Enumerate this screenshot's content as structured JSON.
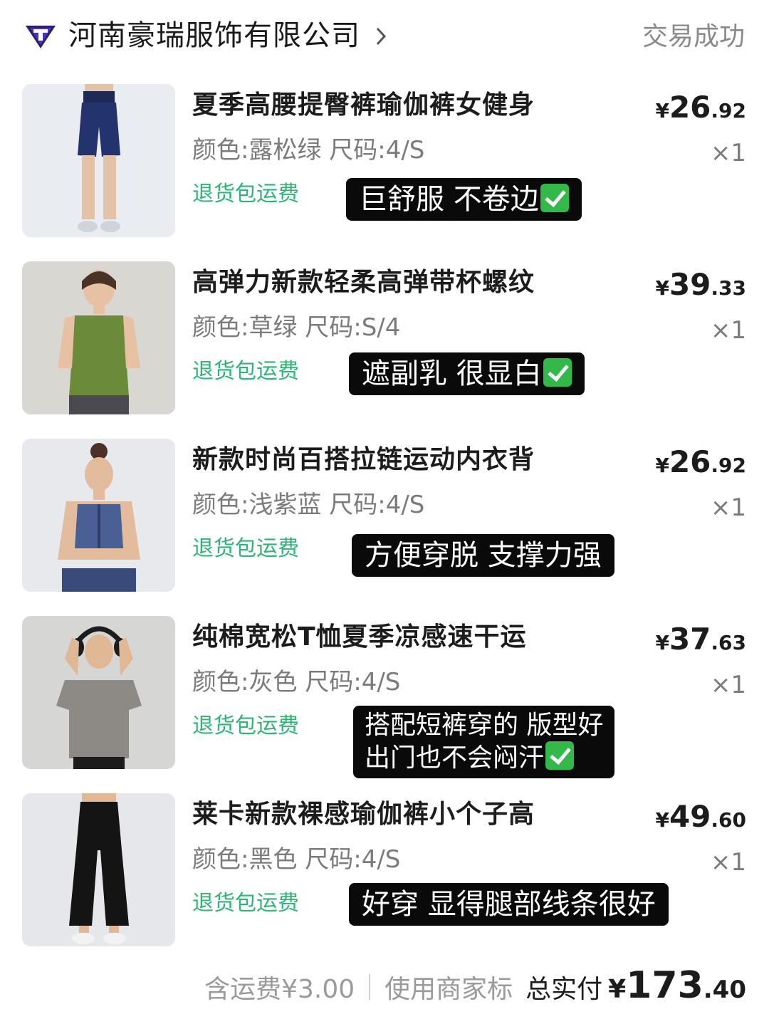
{
  "shop": {
    "name": "河南豪瑞服饰有限公司",
    "status": "交易成功",
    "icons": {
      "logo": "shop-logo-icon",
      "chevron": "chevron-right-icon"
    },
    "colors": {
      "logo": "#2b1e6e",
      "status": "#8a8a8a"
    }
  },
  "items": [
    {
      "title": "夏季高腰提臀裤瑜伽裤女健身",
      "spec": "颜色:露松绿 尺码:4/S",
      "service": "退货包运费",
      "price_currency": "¥",
      "price_int": "26",
      "price_dec": ".92",
      "qty": "×1",
      "note_lines": [
        "巨舒服 不卷边"
      ],
      "note_check": true,
      "image": "navy-biker-shorts"
    },
    {
      "title": "高弹力新款轻柔高弹带杯螺纹",
      "spec": "颜色:草绿 尺码:S/4",
      "service": "退货包运费",
      "price_currency": "¥",
      "price_int": "39",
      "price_dec": ".33",
      "qty": "×1",
      "note_lines": [
        "遮副乳 很显白"
      ],
      "note_check": true,
      "image": "green-tank-top"
    },
    {
      "title": "新款时尚百搭拉链运动内衣背",
      "spec": "颜色:浅紫蓝 尺码:4/S",
      "service": "退货包运费",
      "price_currency": "¥",
      "price_int": "26",
      "price_dec": ".92",
      "qty": "×1",
      "note_lines": [
        "方便穿脱 支撑力强"
      ],
      "note_check": false,
      "image": "blue-zip-sports-bra"
    },
    {
      "title": "纯棉宽松T恤夏季凉感速干运",
      "spec": "颜色:灰色 尺码:4/S",
      "service": "退货包运费",
      "price_currency": "¥",
      "price_int": "37",
      "price_dec": ".63",
      "qty": "×1",
      "note_lines": [
        "搭配短裤穿的 版型好",
        "出门也不会闷汗"
      ],
      "note_check": true,
      "image": "grey-loose-tshirt"
    },
    {
      "title": "莱卡新款裸感瑜伽裤小个子高",
      "spec": "颜色:黑色 尺码:4/S",
      "service": "退货包运费",
      "price_currency": "¥",
      "price_int": "49",
      "price_dec": ".60",
      "qty": "×1",
      "note_lines": [
        "好穿 显得腿部线条很好"
      ],
      "note_check": false,
      "image": "black-flare-yoga-pants"
    }
  ],
  "summary": {
    "shipping": "含运费¥3.00",
    "discount": "使用商家标",
    "total_label": "总实付",
    "total_currency": "¥",
    "total_int": "173",
    "total_dec": ".40"
  },
  "colors": {
    "service_green": "#2bb673",
    "note_bg": "#0a0a0a",
    "check_green": "#33b94a",
    "muted_text": "#7b7b7b"
  }
}
